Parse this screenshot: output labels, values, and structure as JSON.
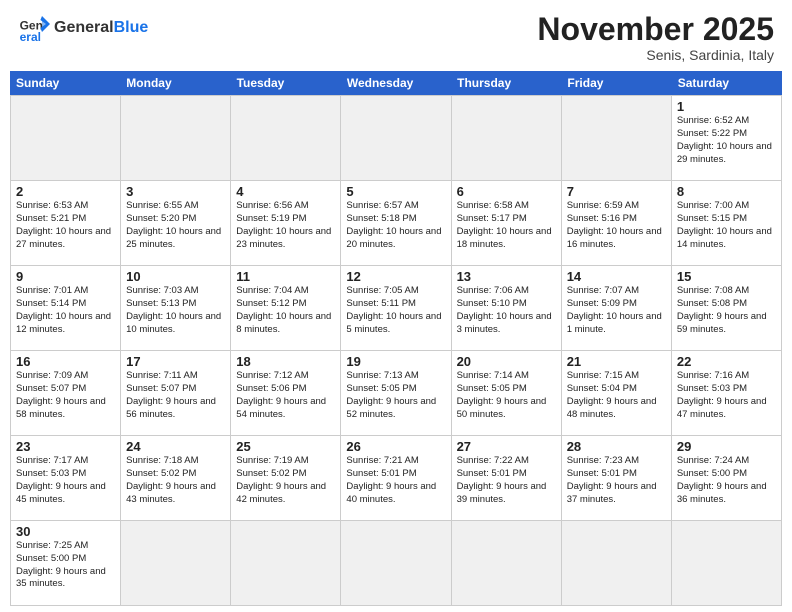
{
  "header": {
    "logo_general": "General",
    "logo_blue": "Blue",
    "month_title": "November 2025",
    "subtitle": "Senis, Sardinia, Italy"
  },
  "calendar": {
    "days_of_week": [
      "Sunday",
      "Monday",
      "Tuesday",
      "Wednesday",
      "Thursday",
      "Friday",
      "Saturday"
    ],
    "weeks": [
      [
        {
          "day": "",
          "info": "",
          "empty": true
        },
        {
          "day": "",
          "info": "",
          "empty": true
        },
        {
          "day": "",
          "info": "",
          "empty": true
        },
        {
          "day": "",
          "info": "",
          "empty": true
        },
        {
          "day": "",
          "info": "",
          "empty": true
        },
        {
          "day": "",
          "info": "",
          "empty": true
        },
        {
          "day": "1",
          "info": "Sunrise: 6:52 AM\nSunset: 5:22 PM\nDaylight: 10 hours and 29 minutes."
        }
      ],
      [
        {
          "day": "2",
          "info": "Sunrise: 6:53 AM\nSunset: 5:21 PM\nDaylight: 10 hours and 27 minutes."
        },
        {
          "day": "3",
          "info": "Sunrise: 6:55 AM\nSunset: 5:20 PM\nDaylight: 10 hours and 25 minutes."
        },
        {
          "day": "4",
          "info": "Sunrise: 6:56 AM\nSunset: 5:19 PM\nDaylight: 10 hours and 23 minutes."
        },
        {
          "day": "5",
          "info": "Sunrise: 6:57 AM\nSunset: 5:18 PM\nDaylight: 10 hours and 20 minutes."
        },
        {
          "day": "6",
          "info": "Sunrise: 6:58 AM\nSunset: 5:17 PM\nDaylight: 10 hours and 18 minutes."
        },
        {
          "day": "7",
          "info": "Sunrise: 6:59 AM\nSunset: 5:16 PM\nDaylight: 10 hours and 16 minutes."
        },
        {
          "day": "8",
          "info": "Sunrise: 7:00 AM\nSunset: 5:15 PM\nDaylight: 10 hours and 14 minutes."
        }
      ],
      [
        {
          "day": "9",
          "info": "Sunrise: 7:01 AM\nSunset: 5:14 PM\nDaylight: 10 hours and 12 minutes."
        },
        {
          "day": "10",
          "info": "Sunrise: 7:03 AM\nSunset: 5:13 PM\nDaylight: 10 hours and 10 minutes."
        },
        {
          "day": "11",
          "info": "Sunrise: 7:04 AM\nSunset: 5:12 PM\nDaylight: 10 hours and 8 minutes."
        },
        {
          "day": "12",
          "info": "Sunrise: 7:05 AM\nSunset: 5:11 PM\nDaylight: 10 hours and 5 minutes."
        },
        {
          "day": "13",
          "info": "Sunrise: 7:06 AM\nSunset: 5:10 PM\nDaylight: 10 hours and 3 minutes."
        },
        {
          "day": "14",
          "info": "Sunrise: 7:07 AM\nSunset: 5:09 PM\nDaylight: 10 hours and 1 minute."
        },
        {
          "day": "15",
          "info": "Sunrise: 7:08 AM\nSunset: 5:08 PM\nDaylight: 9 hours and 59 minutes."
        }
      ],
      [
        {
          "day": "16",
          "info": "Sunrise: 7:09 AM\nSunset: 5:07 PM\nDaylight: 9 hours and 58 minutes."
        },
        {
          "day": "17",
          "info": "Sunrise: 7:11 AM\nSunset: 5:07 PM\nDaylight: 9 hours and 56 minutes."
        },
        {
          "day": "18",
          "info": "Sunrise: 7:12 AM\nSunset: 5:06 PM\nDaylight: 9 hours and 54 minutes."
        },
        {
          "day": "19",
          "info": "Sunrise: 7:13 AM\nSunset: 5:05 PM\nDaylight: 9 hours and 52 minutes."
        },
        {
          "day": "20",
          "info": "Sunrise: 7:14 AM\nSunset: 5:05 PM\nDaylight: 9 hours and 50 minutes."
        },
        {
          "day": "21",
          "info": "Sunrise: 7:15 AM\nSunset: 5:04 PM\nDaylight: 9 hours and 48 minutes."
        },
        {
          "day": "22",
          "info": "Sunrise: 7:16 AM\nSunset: 5:03 PM\nDaylight: 9 hours and 47 minutes."
        }
      ],
      [
        {
          "day": "23",
          "info": "Sunrise: 7:17 AM\nSunset: 5:03 PM\nDaylight: 9 hours and 45 minutes."
        },
        {
          "day": "24",
          "info": "Sunrise: 7:18 AM\nSunset: 5:02 PM\nDaylight: 9 hours and 43 minutes."
        },
        {
          "day": "25",
          "info": "Sunrise: 7:19 AM\nSunset: 5:02 PM\nDaylight: 9 hours and 42 minutes."
        },
        {
          "day": "26",
          "info": "Sunrise: 7:21 AM\nSunset: 5:01 PM\nDaylight: 9 hours and 40 minutes."
        },
        {
          "day": "27",
          "info": "Sunrise: 7:22 AM\nSunset: 5:01 PM\nDaylight: 9 hours and 39 minutes."
        },
        {
          "day": "28",
          "info": "Sunrise: 7:23 AM\nSunset: 5:01 PM\nDaylight: 9 hours and 37 minutes."
        },
        {
          "day": "29",
          "info": "Sunrise: 7:24 AM\nSunset: 5:00 PM\nDaylight: 9 hours and 36 minutes."
        }
      ],
      [
        {
          "day": "30",
          "info": "Sunrise: 7:25 AM\nSunset: 5:00 PM\nDaylight: 9 hours and 35 minutes."
        },
        {
          "day": "",
          "info": "",
          "empty": true
        },
        {
          "day": "",
          "info": "",
          "empty": true
        },
        {
          "day": "",
          "info": "",
          "empty": true
        },
        {
          "day": "",
          "info": "",
          "empty": true
        },
        {
          "day": "",
          "info": "",
          "empty": true
        },
        {
          "day": "",
          "info": "",
          "empty": true
        }
      ]
    ]
  }
}
